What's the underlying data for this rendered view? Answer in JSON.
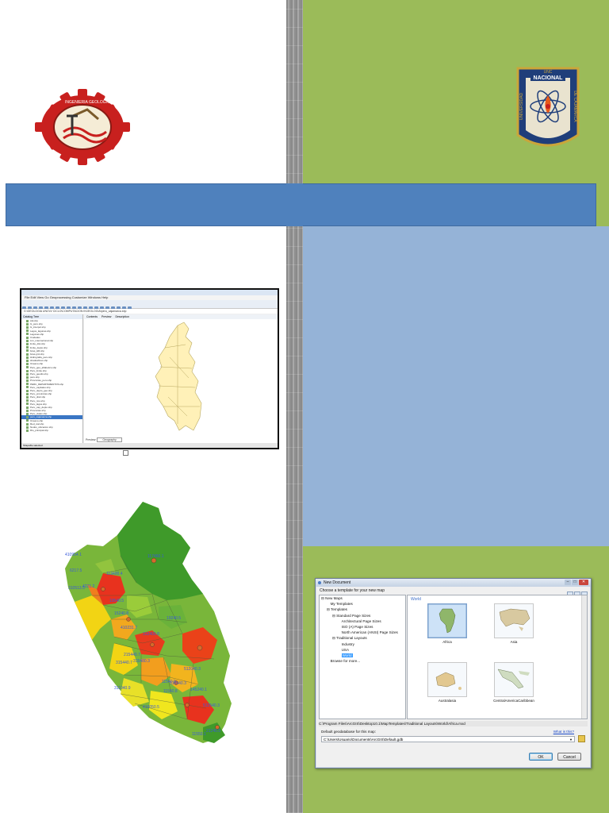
{
  "colors": {
    "green": "#9bbb59",
    "blue_banner": "#4f81bd",
    "blue_panel": "#95b3d7",
    "map_label_blue": "#3a5bd9"
  },
  "logos": {
    "right_logo_text_top": "UNC",
    "right_logo_text_nacional": "NACIONAL",
    "right_logo_text_left": "UNIVERSIDAD",
    "right_logo_text_right": "DE CAJAMARCA",
    "left_logo_icon": "gear-emblem-icon",
    "right_logo_icon": "atom-shield-icon"
  },
  "arcmap": {
    "menu": "File  Edit  View  Go  Geoprocessing  Customize  Windows  Help",
    "path": "G:\\GEOLOGIA UNC\\IV CICLO\\COMPUTACION II\\GEOLOGIA\\peru_cajamarca.shp",
    "catalog_title": "Catalog Tree",
    "catalog_items": [
      "Atk.shp",
      "G_peru.shp",
      "G_interpol.shp",
      "Lagos_lagunas.shp",
      "Lagunas.shp",
      "Ciudades",
      "Lim_internacional.shp",
      "limite_dist.shp",
      "limite_depto.shp",
      "bcas_HR.shp",
      "bcas.gml.shp",
      "Hidrografia_peru.shp",
      "shadowlines.shp",
      "Oceano.shp",
      "Peru_geo_alfabetico.shp",
      "Peru_limite.shp",
      "Peru_geodis.shp",
      "peru.shp",
      "Provincias_peru.shp",
      "PERU_DEPARTAMENTOS.shp",
      "Peru_capitales.shp",
      "Peru_depto_geo.shp",
      "Peru_provincias.shp",
      "Peru_distr.shp",
      "Peru_rios.shp",
      "Peru_lagos.shp",
      "Peru_cap_depto.shp",
      "Provincias.shp",
      "Peru_viales.shp",
      "peru_cajamarca.shp",
      "Oceano.shp",
      "Red_vial.shp",
      "Nodos_ubicacion.shp",
      "Rio_principal.shp"
    ],
    "selected_index": 29,
    "tabs": [
      "Contents",
      "Preview",
      "Description"
    ],
    "preview_label": "Preview:",
    "preview_value": "Geography",
    "status": "Shapefile selected"
  },
  "peru_map": {
    "labels": [
      "410954.1",
      "6217.5",
      "310513.5",
      "4221.2",
      "113400.4",
      "117460.1",
      "19540.5",
      "15240.8",
      "410231.7",
      "19240.5",
      "313400.8",
      "215440.7",
      "315440.7",
      "315480.3",
      "311040.9",
      "512040.3",
      "515540.3",
      "11540.8",
      "145240.1",
      "512540.3",
      "21240.5",
      "11550.1",
      "410050.5",
      "11540.9"
    ]
  },
  "dialog": {
    "title": "New Document",
    "prompt": "Choose a template for your new map",
    "tree": [
      {
        "label": "New Maps",
        "level": 0,
        "sign": "⊟"
      },
      {
        "label": "My Templates",
        "level": 1,
        "sign": ""
      },
      {
        "label": "Templates",
        "level": 1,
        "sign": "⊟"
      },
      {
        "label": "Standard Page Sizes",
        "level": 2,
        "sign": "⊟"
      },
      {
        "label": "Architectural Page Sizes",
        "level": 3,
        "sign": ""
      },
      {
        "label": "ISO (A) Page Sizes",
        "level": 3,
        "sign": ""
      },
      {
        "label": "North American (ANSI) Page Sizes",
        "level": 3,
        "sign": ""
      },
      {
        "label": "Traditional Layouts",
        "level": 2,
        "sign": "⊟"
      },
      {
        "label": "Industry",
        "level": 3,
        "sign": ""
      },
      {
        "label": "USA",
        "level": 3,
        "sign": ""
      },
      {
        "label": "World",
        "level": 3,
        "sign": "",
        "selected": true
      },
      {
        "label": "Browse for more...",
        "level": 1,
        "sign": ""
      }
    ],
    "gallery_heading": "World",
    "thumbnails": [
      "Africa",
      "Asia",
      "Australasia",
      "CentralAmericaCaribbean"
    ],
    "template_path": "C:\\Program Files\\ArcGIS\\Desktop10.1\\MapTemplates\\Traditional Layouts\\World\\Africa.mxd",
    "gdb_label": "Default geodatabase for this map:",
    "help_link": "What is this?",
    "gdb_value": "C:\\Users\\Usuario\\Documents\\ArcGIS\\Default.gdb",
    "ok_label": "OK",
    "cancel_label": "Cancel"
  }
}
